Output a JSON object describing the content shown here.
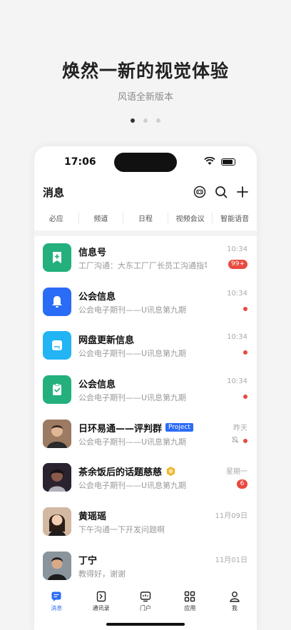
{
  "promo": {
    "title": "焕然一新的视觉体验",
    "subtitle": "风语全新版本"
  },
  "status_bar": {
    "time": "17:06"
  },
  "header": {
    "title": "消息",
    "icons": [
      "bot-icon",
      "search-icon",
      "plus-icon"
    ]
  },
  "tabs": [
    "必应",
    "频道",
    "日程",
    "视频会议",
    "智能语音"
  ],
  "messages": [
    {
      "title": "信息号",
      "subtitle": "工厂沟通：大东工厂厂长员工沟通指导工...",
      "time": "10:34",
      "badge": "99+",
      "icon": "bookmark-plus-icon",
      "color": "#23b07d"
    },
    {
      "title": "公会信息",
      "subtitle": "公会电子期刊——U讯息第九期",
      "time": "10:34",
      "icon": "bell-icon",
      "color": "#2b6cf6"
    },
    {
      "title": "网盘更新信息",
      "subtitle": "公会电子期刊——U讯息第九期",
      "time": "10:34",
      "icon": "drive-icon",
      "color": "#22b4f5"
    },
    {
      "title": "公会信息",
      "subtitle": "公会电子期刊——U讯息第九期",
      "time": "10:34",
      "icon": "clipboard-check-icon",
      "color": "#23b07d"
    },
    {
      "title": "日环易通——评判群",
      "tag": "Project",
      "subtitle": "公会电子期刊——U讯息第九期",
      "time": "昨天",
      "muted": true
    },
    {
      "title": "茶余饭后的话题慈慈",
      "subtitle": "公会电子期刊——U讯息第九期",
      "time": "星期一",
      "badge": "6",
      "icon": "hexagon-badge-icon"
    },
    {
      "title": "黄瑶瑶",
      "subtitle": "下午沟通一下开发问题啊",
      "time": "11月09日"
    },
    {
      "title": "丁宁",
      "subtitle": "教得好，谢谢",
      "time": "11月01日"
    }
  ],
  "bottom_nav": [
    {
      "label": "消息",
      "icon": "message-icon",
      "active": true
    },
    {
      "label": "通讯录",
      "icon": "contacts-icon"
    },
    {
      "label": "门户",
      "icon": "portal-icon"
    },
    {
      "label": "应用",
      "icon": "apps-icon"
    },
    {
      "label": "我",
      "icon": "person-icon"
    }
  ]
}
